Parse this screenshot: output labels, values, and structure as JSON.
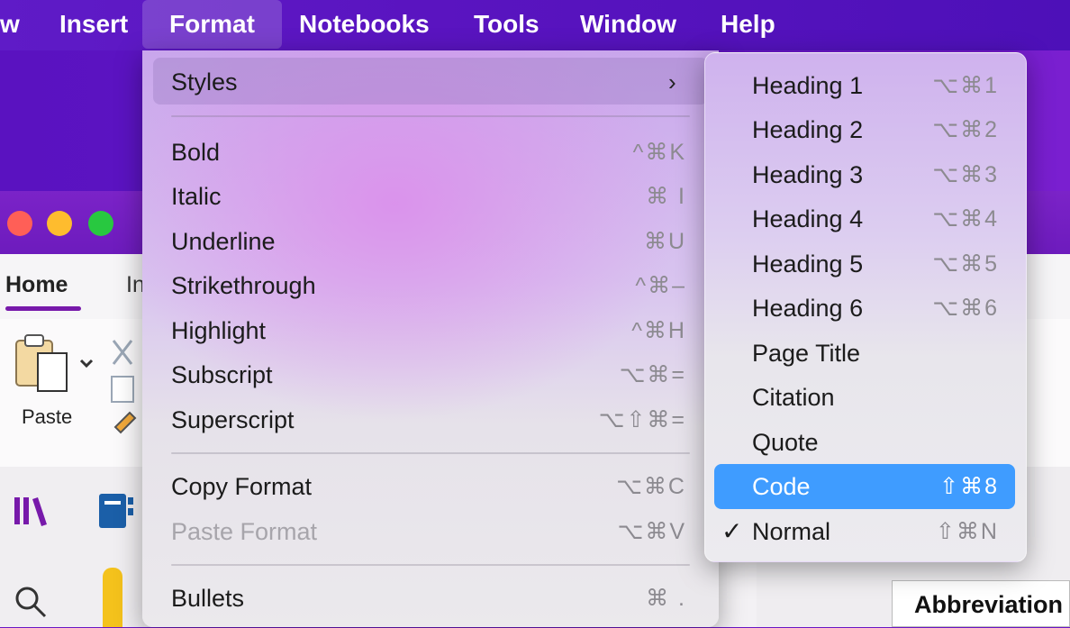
{
  "menubar": {
    "items": [
      "w",
      "Insert",
      "Format",
      "Notebooks",
      "Tools",
      "Window",
      "Help"
    ],
    "active": "Format"
  },
  "app": {
    "tabs": {
      "home": "Home",
      "next": "In"
    },
    "paste_label": "Paste",
    "cell_text": "Abbreviation"
  },
  "format_menu": {
    "styles": {
      "label": "Styles",
      "chevron": "›"
    },
    "items": [
      {
        "label": "Bold",
        "shortcut": "^⌘K"
      },
      {
        "label": "Italic",
        "shortcut": "⌘ I"
      },
      {
        "label": "Underline",
        "shortcut": "⌘U"
      },
      {
        "label": "Strikethrough",
        "shortcut": "^⌘–"
      },
      {
        "label": "Highlight",
        "shortcut": "^⌘H"
      },
      {
        "label": "Subscript",
        "shortcut": "⌥⌘="
      },
      {
        "label": "Superscript",
        "shortcut": "⌥⇧⌘="
      },
      {
        "label": "Copy Format",
        "shortcut": "⌥⌘C"
      },
      {
        "label": "Paste Format",
        "shortcut": "⌥⌘V",
        "disabled": true
      },
      {
        "label": "Bullets",
        "shortcut": "⌘ ."
      }
    ]
  },
  "styles_menu": {
    "items": [
      {
        "label": "Heading 1",
        "shortcut": "⌥⌘1"
      },
      {
        "label": "Heading 2",
        "shortcut": "⌥⌘2"
      },
      {
        "label": "Heading 3",
        "shortcut": "⌥⌘3"
      },
      {
        "label": "Heading 4",
        "shortcut": "⌥⌘4"
      },
      {
        "label": "Heading 5",
        "shortcut": "⌥⌘5"
      },
      {
        "label": "Heading 6",
        "shortcut": "⌥⌘6"
      },
      {
        "label": "Page Title",
        "shortcut": ""
      },
      {
        "label": "Citation",
        "shortcut": ""
      },
      {
        "label": "Quote",
        "shortcut": ""
      },
      {
        "label": "Code",
        "shortcut": "⇧⌘8",
        "selected": true
      },
      {
        "label": "Normal",
        "shortcut": "⇧⌘N",
        "checked": true
      }
    ],
    "check_mark": "✓"
  },
  "colors": {
    "accent_purple": "#7719aa",
    "selection_blue": "#3f9cff"
  }
}
